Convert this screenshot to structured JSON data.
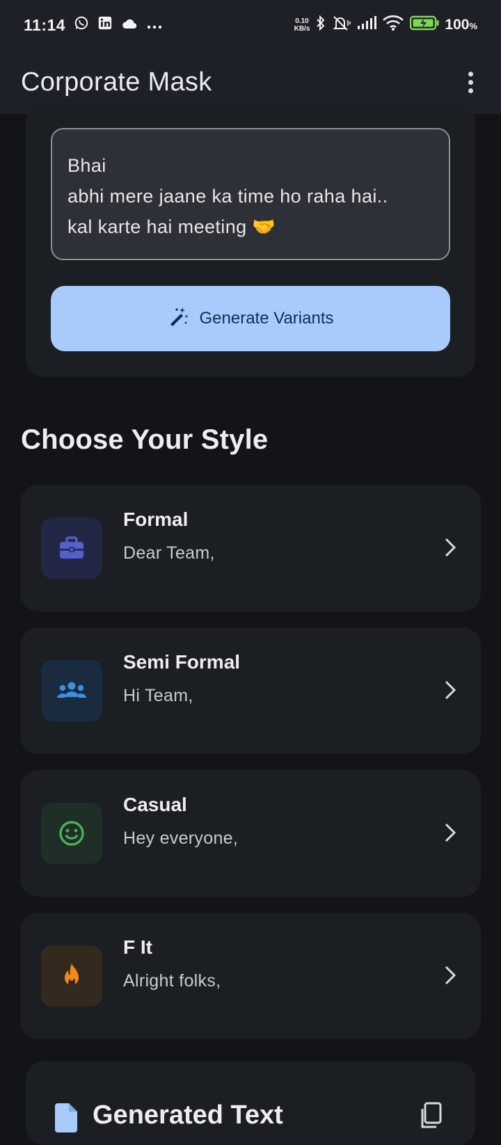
{
  "status_bar": {
    "time": "11:14",
    "net_speed_value": "0.10",
    "net_speed_unit": "KB/s",
    "battery": "100",
    "battery_unit": "%",
    "icons": [
      "whatsapp-icon",
      "linkedin-icon",
      "cloud-icon",
      "more-dots-icon",
      "bluetooth-icon",
      "mute-icon",
      "signal-icon",
      "wifi-icon",
      "battery-icon"
    ]
  },
  "app_bar": {
    "title": "Corporate Mask",
    "menu_icon": "more-vert-icon"
  },
  "input": {
    "text": "Bhai\nabhi mere jaane ka time ho raha hai..\nkal karte hai meeting 🤝"
  },
  "generate_button": {
    "label": "Generate Variants",
    "icon": "magic-wand-icon"
  },
  "styles_section": {
    "title": "Choose Your Style",
    "items": [
      {
        "name": "Formal",
        "preview": "Dear Team,",
        "icon": "briefcase-icon",
        "color": "#5560c8",
        "bg": "#222745"
      },
      {
        "name": "Semi Formal",
        "preview": "Hi Team,",
        "icon": "group-icon",
        "color": "#3d8fe0",
        "bg": "#1a2b40"
      },
      {
        "name": "Casual",
        "preview": "Hey everyone,",
        "icon": "smiley-icon",
        "color": "#4bb05a",
        "bg": "#1f2e26"
      },
      {
        "name": "F It",
        "preview": "Alright folks,",
        "icon": "fire-icon",
        "color": "#f28a1a",
        "bg": "#33291f"
      }
    ]
  },
  "generated": {
    "title": "Generated Text",
    "icon": "document-icon",
    "copy_icon": "copy-icon"
  },
  "colors": {
    "background": "#121418",
    "app_bar": "#1d2127",
    "card": "#1b1e23",
    "accent_button": "#a8cbfb"
  }
}
